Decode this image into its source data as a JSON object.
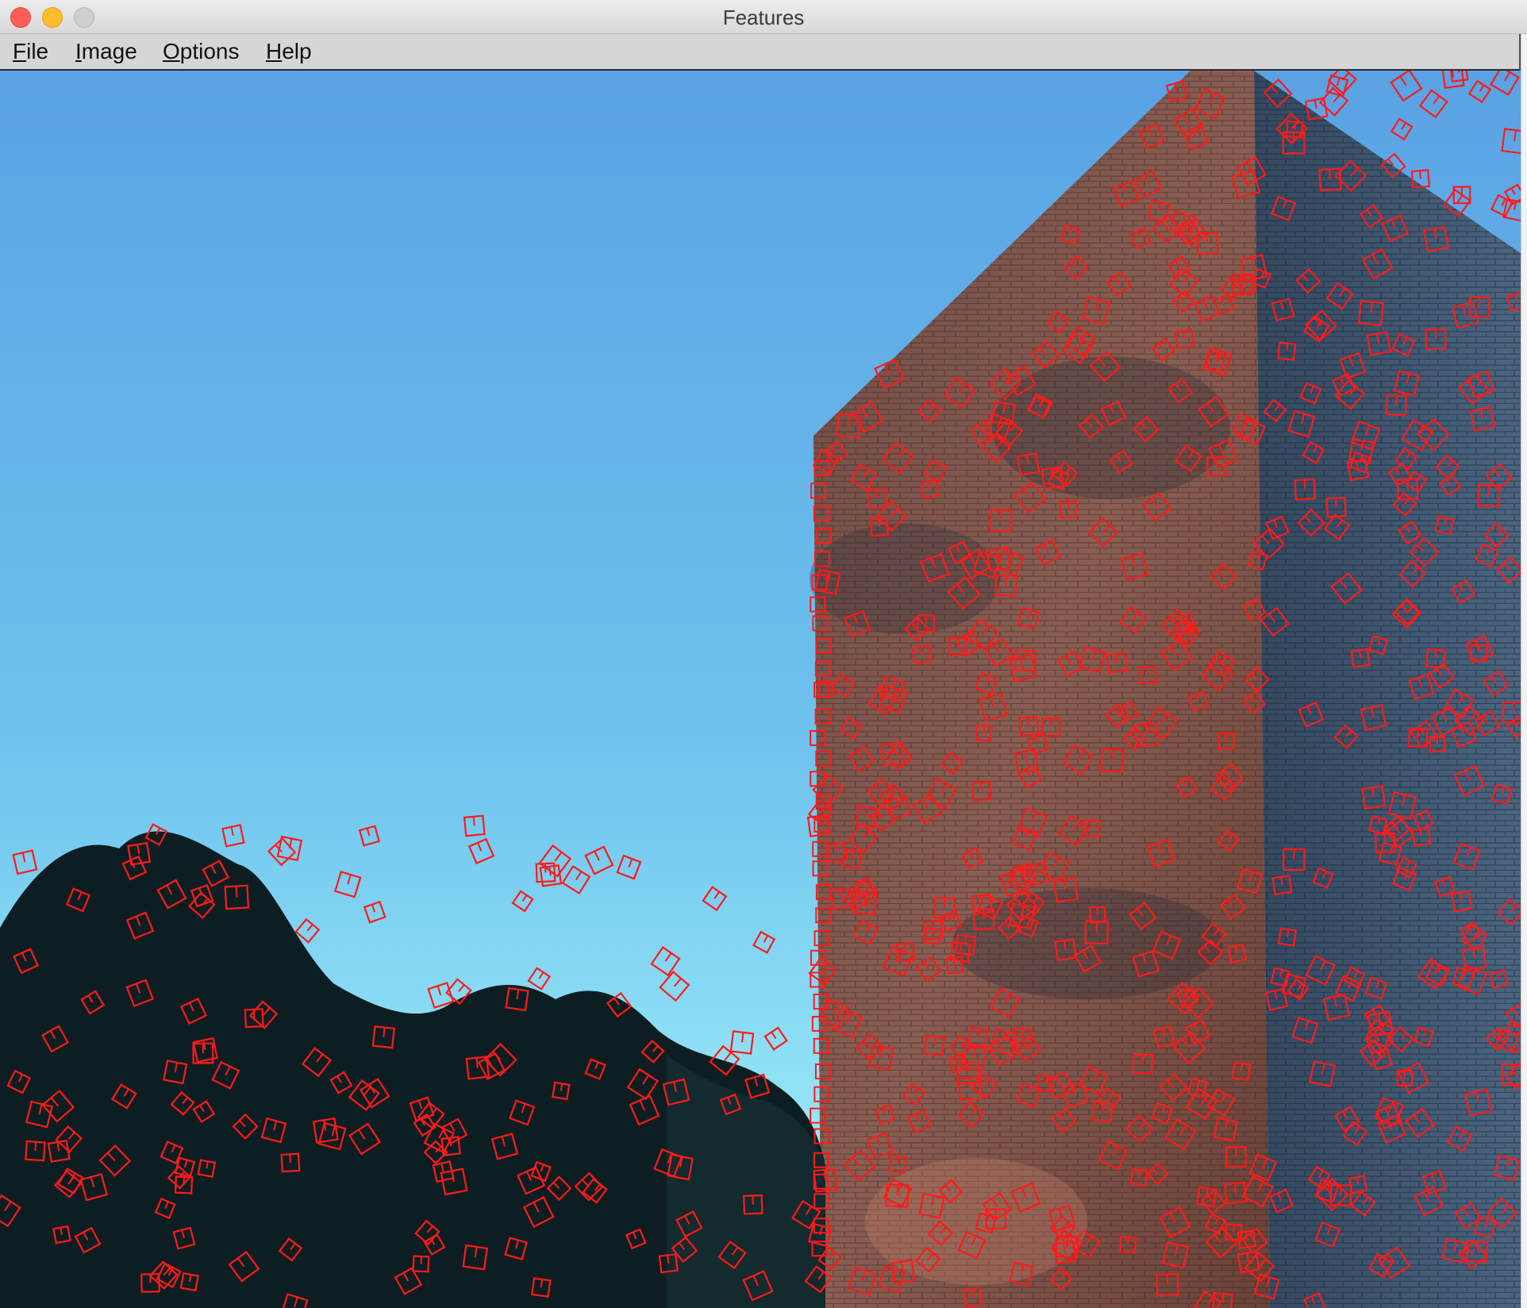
{
  "window": {
    "title": "Features"
  },
  "menu": {
    "items": [
      {
        "mnemonic": "F",
        "rest": "ile"
      },
      {
        "mnemonic": "I",
        "rest": "mage"
      },
      {
        "mnemonic": "O",
        "rest": "ptions"
      },
      {
        "mnemonic": "H",
        "rest": "elp"
      }
    ]
  },
  "colors": {
    "feature_marker": "#ff1a1a",
    "sky_top": "#5aa2e4",
    "sky_bottom": "#a8f6fb",
    "brick_face": "#7a5048",
    "brick_side": "#3b4f66",
    "trees": "#0d1e22"
  },
  "image": {
    "description_name": "building-with-features",
    "features_count": 642
  }
}
